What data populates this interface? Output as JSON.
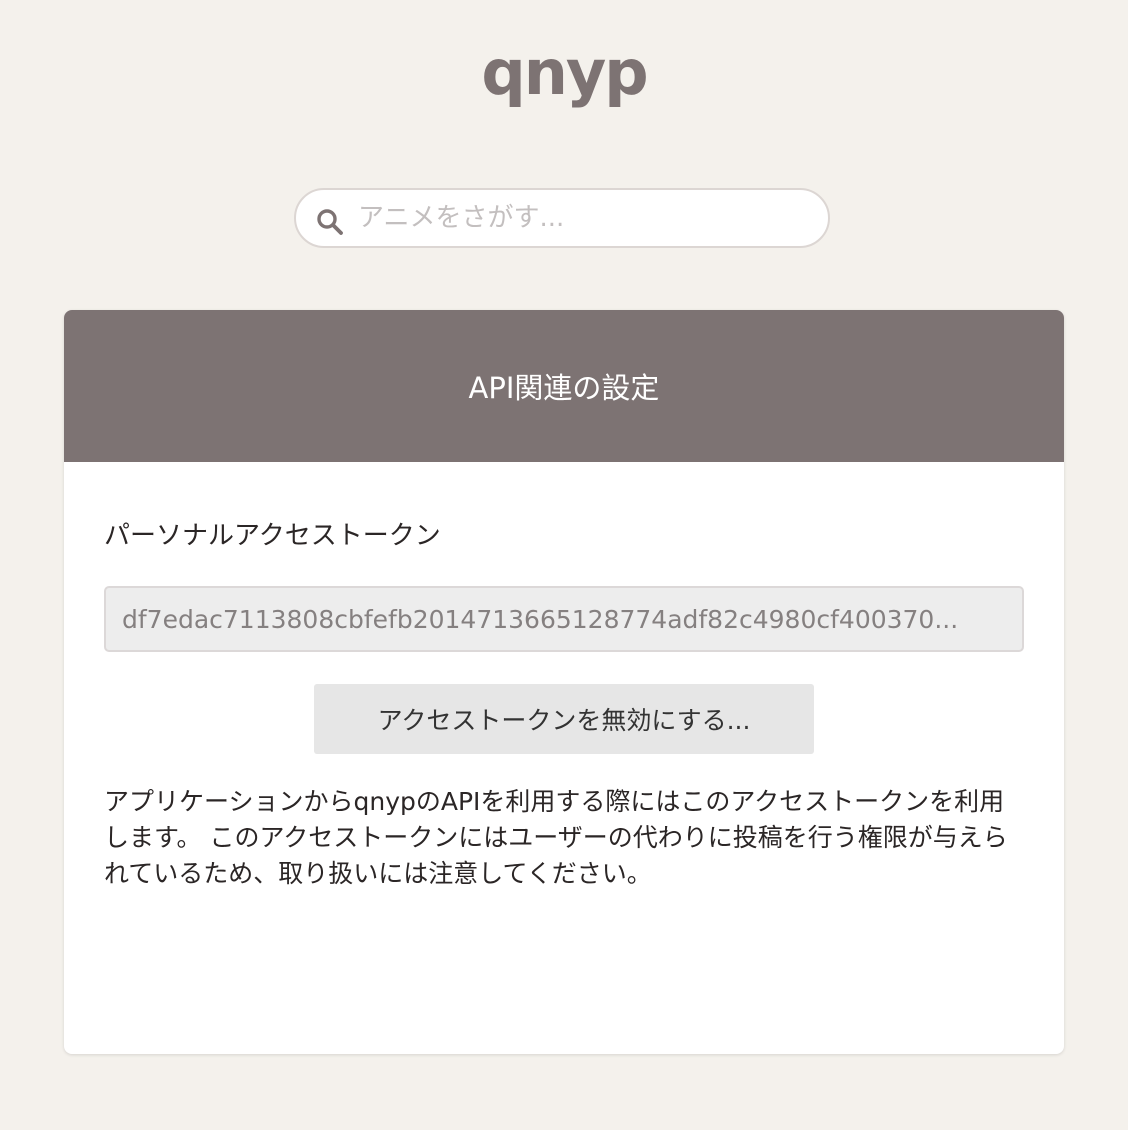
{
  "app": {
    "logo_text": "qnyp",
    "logo_color": "#7d7373",
    "background_color": "#f4f1ec"
  },
  "search": {
    "placeholder": "アニメをさがす...",
    "value": "",
    "icon": "search-icon"
  },
  "card": {
    "title": "API関連の設定",
    "header_color": "#7d7373",
    "section_label": "パーソナルアクセストークン",
    "token_value": "df7edac7113808cbfefb2014713665128774adf82c4980cf400370...",
    "revoke_button_label": "アクセストークンを無効にする...",
    "description": "アプリケーションからqnypのAPIを利用する際にはこのアクセストークンを利用します。 このアクセストークンにはユーザーの代わりに投稿を行う権限が与えられているため、取り扱いには注意してください。"
  }
}
